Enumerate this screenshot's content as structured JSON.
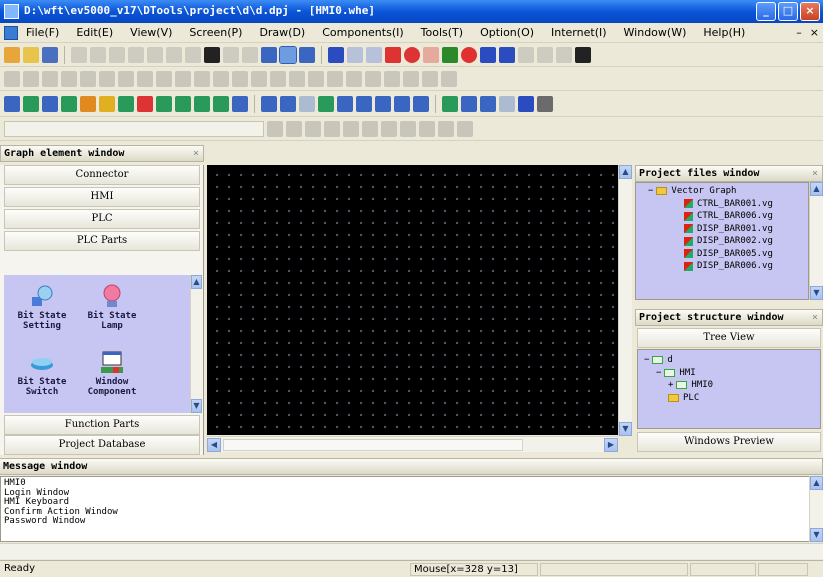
{
  "window": {
    "title": "D:\\wft\\ev5000_v17\\DTools\\project\\d\\d.dpj - [HMI0.whe]",
    "buttons": [
      "_",
      "□",
      "×"
    ]
  },
  "menubar": {
    "items": [
      "File(F)",
      "Edit(E)",
      "View(V)",
      "Screen(P)",
      "Draw(D)",
      "Components(I)",
      "Tools(T)",
      "Option(O)",
      "Internet(I)",
      "Window(W)",
      "Help(H)"
    ],
    "mdi_buttons": [
      "–",
      "×"
    ]
  },
  "left_panel": {
    "title": "Graph element window",
    "categories": [
      "Connector",
      "HMI",
      "PLC",
      "PLC Parts"
    ],
    "parts": [
      {
        "label1": "Bit State",
        "label2": "Setting",
        "icon": "bit-state-setting-icon"
      },
      {
        "label1": "Bit State",
        "label2": "Lamp",
        "icon": "bit-state-lamp-icon"
      },
      {
        "label1": "Bit State",
        "label2": "Switch",
        "icon": "bit-state-switch-icon"
      },
      {
        "label1": "Window",
        "label2": "Component",
        "icon": "window-component-icon"
      }
    ],
    "bottom_categories": [
      "Function Parts",
      "Project Database"
    ]
  },
  "project_files": {
    "title": "Project files window",
    "folder": "Vector Graph",
    "files": [
      "CTRL_BAR001.vg",
      "CTRL_BAR006.vg",
      "DISP_BAR001.vg",
      "DISP_BAR002.vg",
      "DISP_BAR005.vg",
      "DISP_BAR006.vg"
    ]
  },
  "project_structure": {
    "title": "Project structure window",
    "tab": "Tree View",
    "root": "d",
    "hmi": "HMI",
    "screen": "HMI0",
    "plc": "PLC",
    "preview_tab": "Windows Preview"
  },
  "message_window": {
    "title": "Message window",
    "lines": [
      "HMI0",
      "Login Window",
      "HMI Keyboard",
      "Confirm Action Window",
      "Password Window"
    ]
  },
  "statusbar": {
    "ready": "Ready",
    "mouse": "Mouse[x=328  y=13]"
  },
  "colors": {
    "titlebar": "#0a55d8",
    "canvas": "#000000",
    "parts_bg": "#c7c6f2",
    "tree_bg": "#c7c6f2"
  }
}
